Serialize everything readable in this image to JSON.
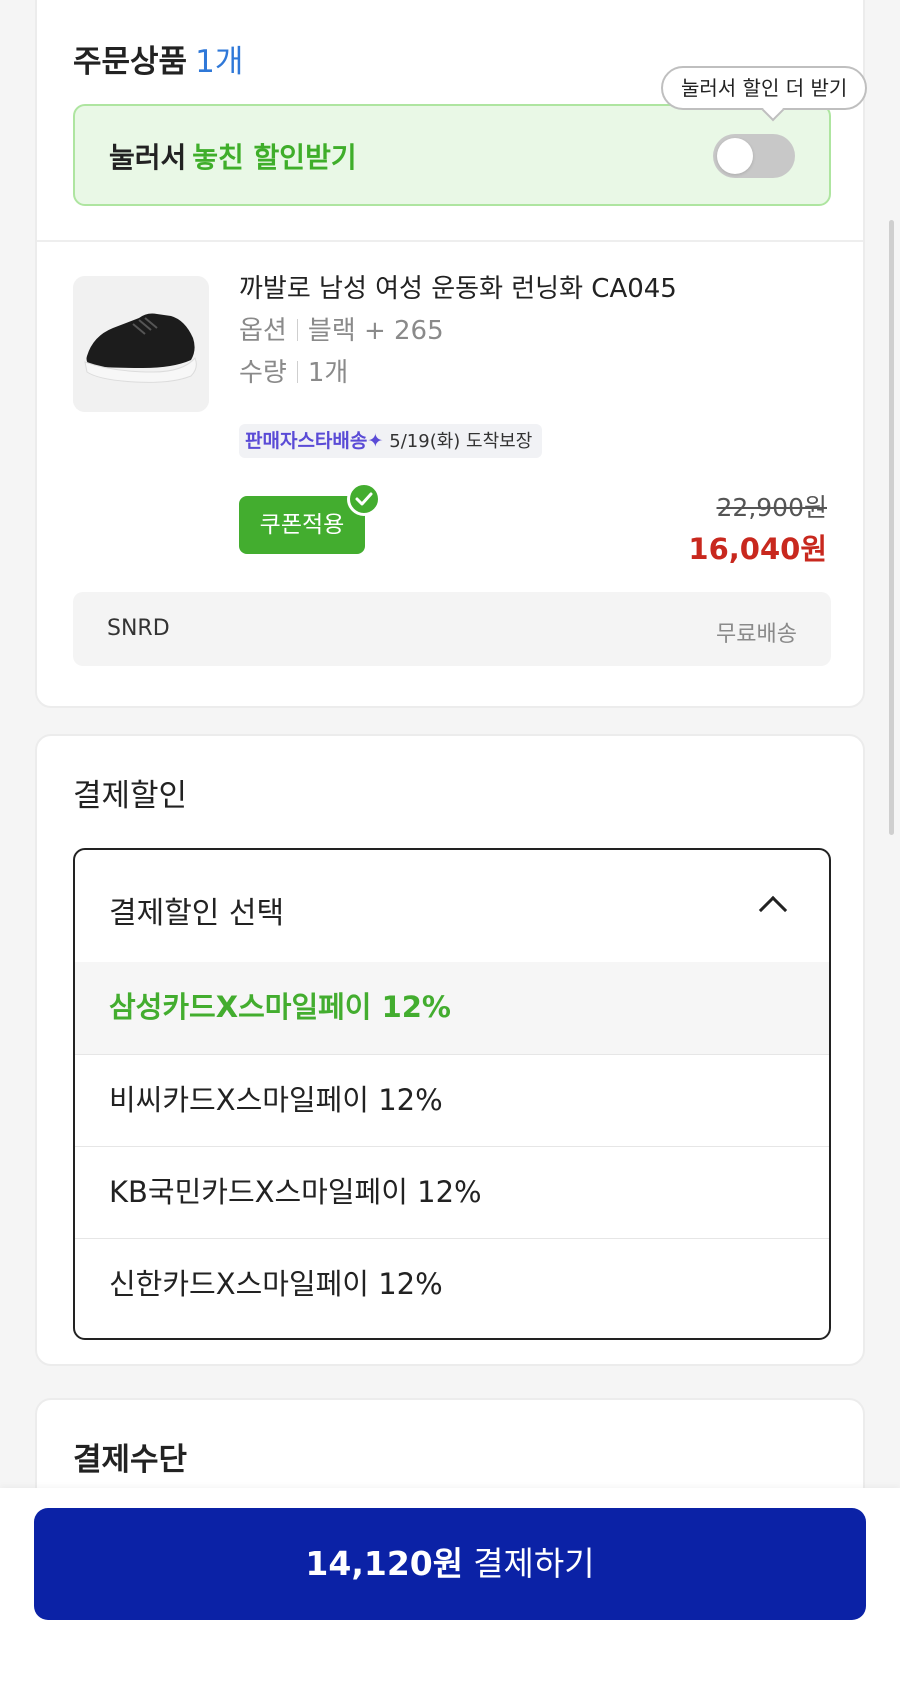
{
  "order": {
    "title": "주문상품",
    "count": "1개",
    "promo_prefix": "눌러서",
    "promo_highlight": "놓친 할인받기",
    "tooltip": "눌러서 할인 더 받기",
    "toggle_on": false
  },
  "product": {
    "name": "까발로 남성 여성 운동화 런닝화 CA045",
    "option_label": "옵션",
    "option_value": "블랙 + 265",
    "qty_label": "수량",
    "qty_value": "1개",
    "delivery_logo": "판매자스타배송✦",
    "delivery_text": "5/19(화) 도착보장",
    "coupon_label": "쿠폰적용",
    "original_price": "22,900원",
    "sale_price": "16,040원",
    "seller": "SNRD",
    "shipping": "무료배송",
    "image_icon": "sneaker-image"
  },
  "discount": {
    "title": "결제할인",
    "select_label": "결제할인 선택",
    "options": [
      "삼성카드X스마일페이 12%",
      "비씨카드X스마일페이 12%",
      "KB국민카드X스마일페이 12%",
      "신한카드X스마일페이 12%"
    ],
    "selected_index": 0
  },
  "method": {
    "title": "결제수단"
  },
  "pay": {
    "amount": "14,120원",
    "label": "결제하기"
  },
  "colors": {
    "accent_green": "#43ad2f",
    "sale_red": "#c8281e",
    "pay_blue": "#0b22a6",
    "count_blue": "#2f78d8"
  }
}
